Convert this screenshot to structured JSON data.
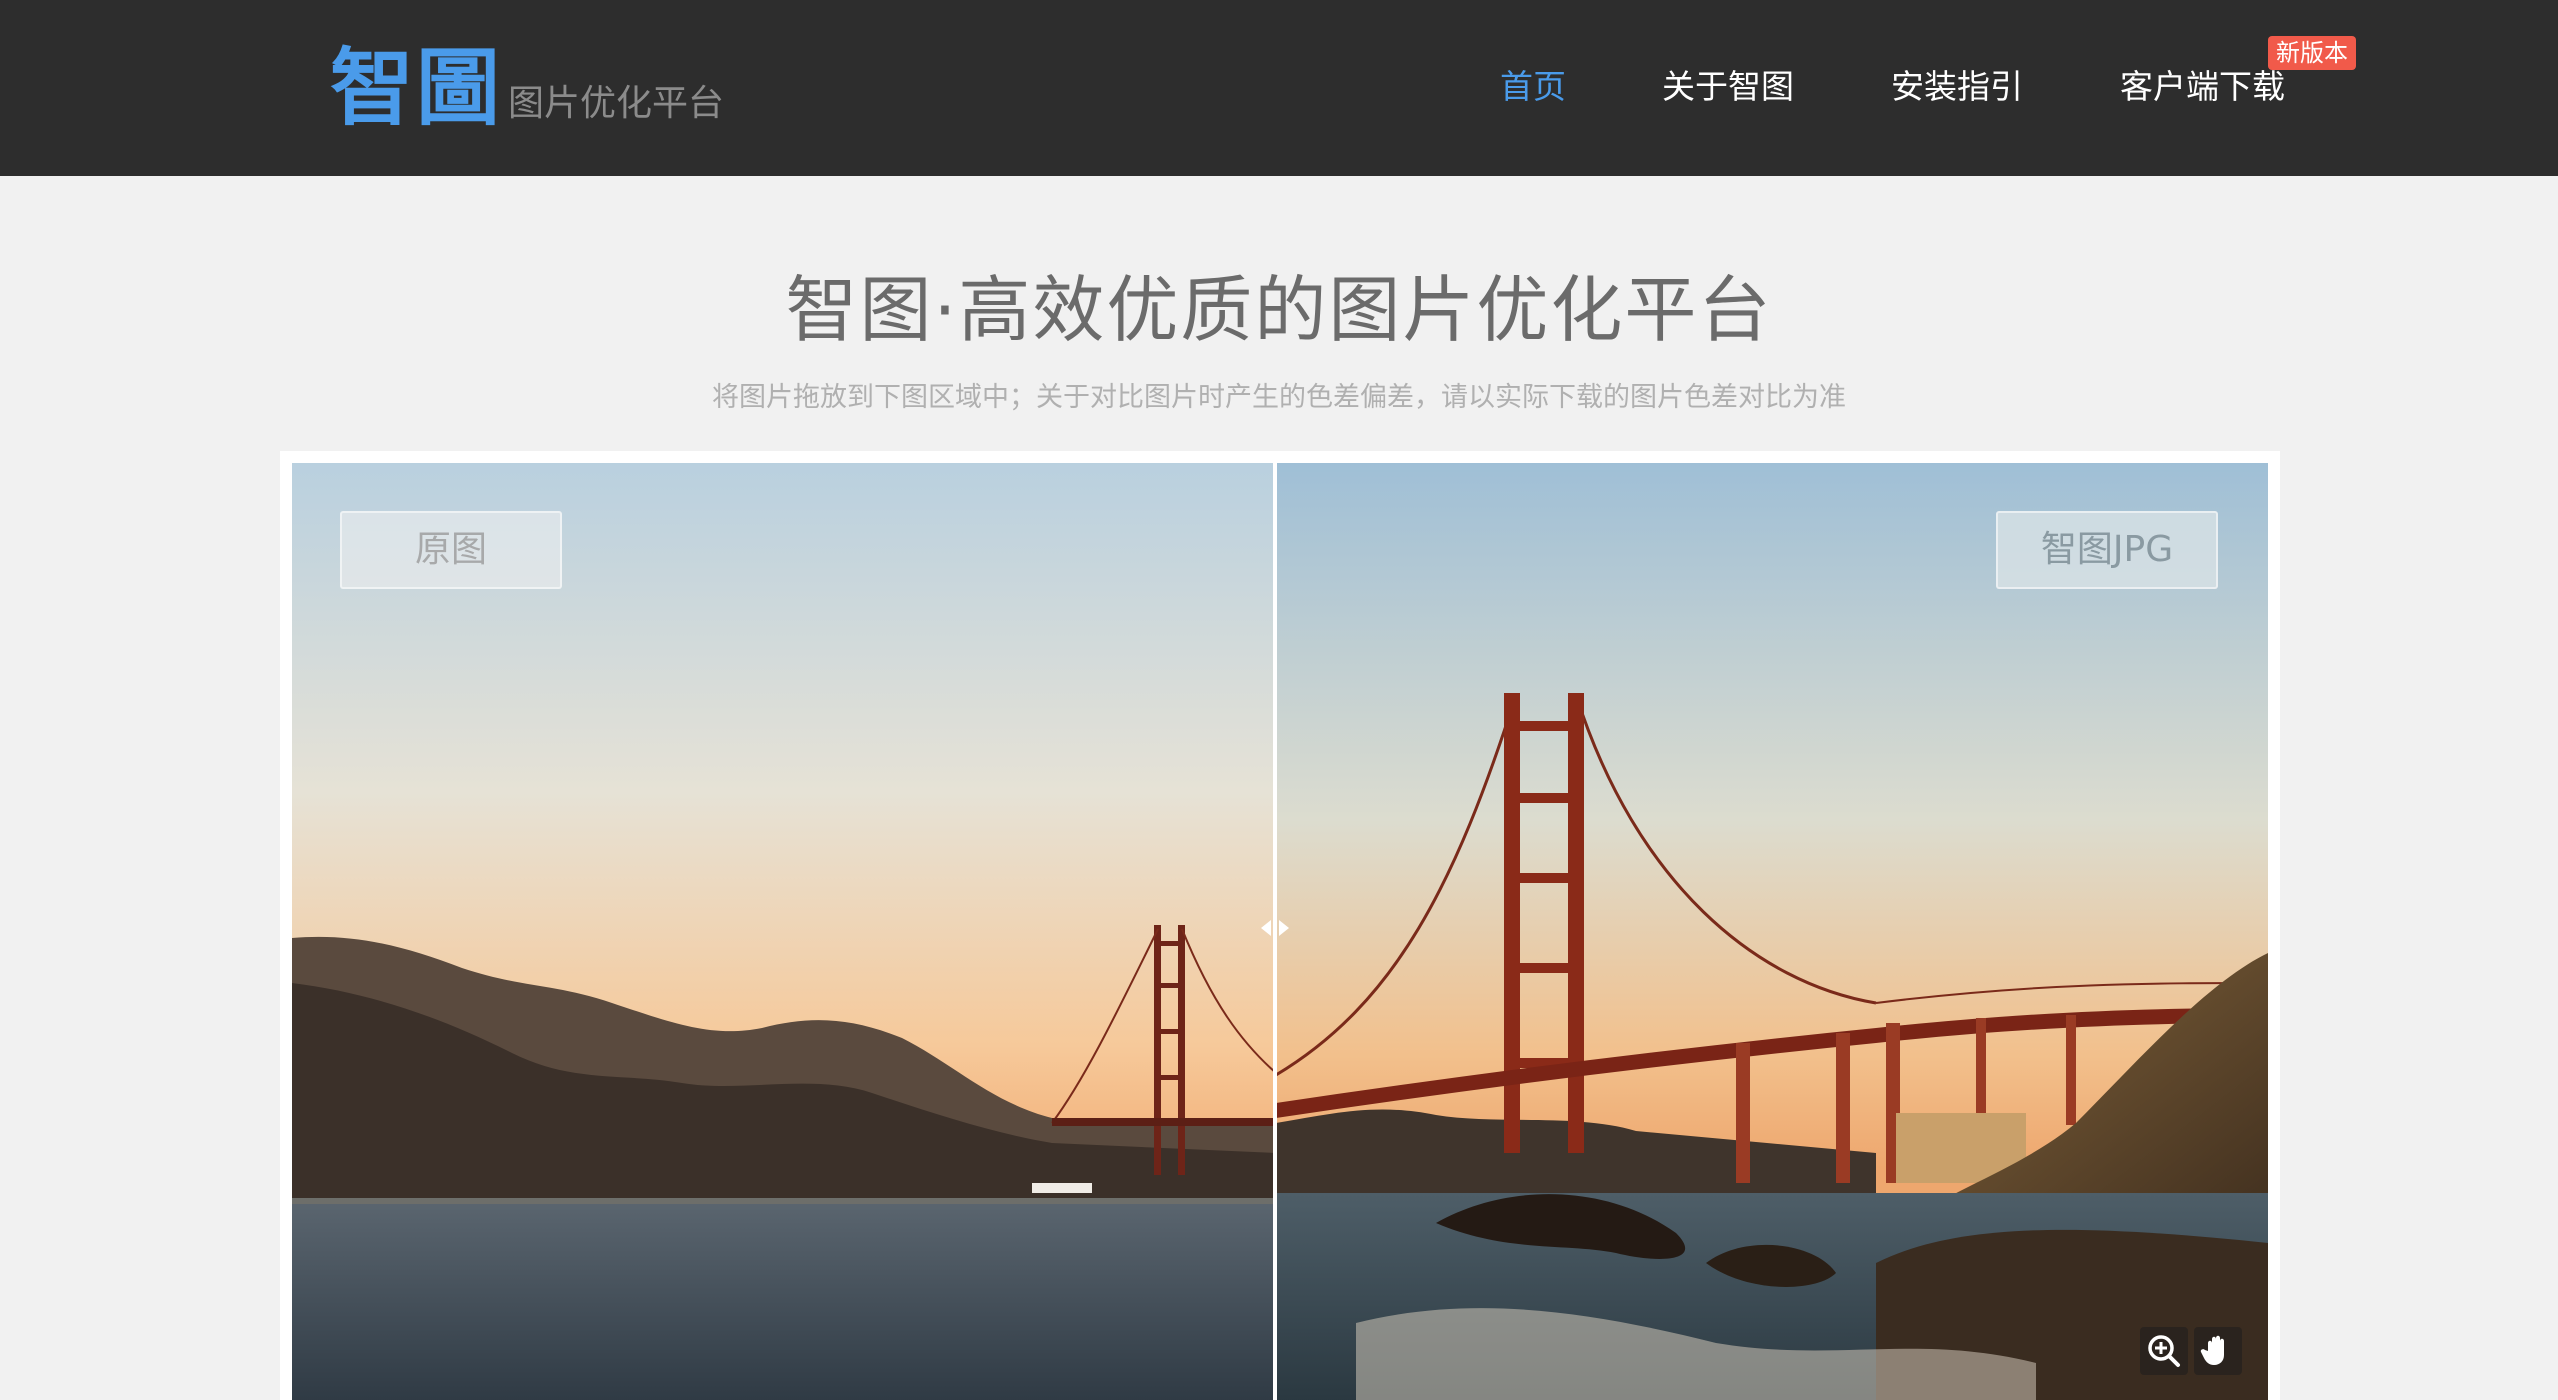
{
  "header": {
    "logo": "智圖",
    "logo_sub": "图片优化平台",
    "nav": [
      {
        "label": "首页",
        "active": true
      },
      {
        "label": "关于智图"
      },
      {
        "label": "安装指引"
      },
      {
        "label": "客户端下载",
        "badge": "新版本"
      }
    ]
  },
  "hero": {
    "title": "智图·高效优质的图片优化平台",
    "subtitle": "将图片拖放到下图区域中；关于对比图片时产生的色差偏差，请以实际下载的图片色差对比为准"
  },
  "compare": {
    "left_label": "原图",
    "right_label": "智图JPG",
    "tools": [
      "zoom-in-icon",
      "hand-drag-icon"
    ]
  },
  "colors": {
    "header_bg": "#2d2d2d",
    "accent": "#4a9bea",
    "badge": "#f15a4a",
    "page_bg": "#f1f1f1"
  }
}
